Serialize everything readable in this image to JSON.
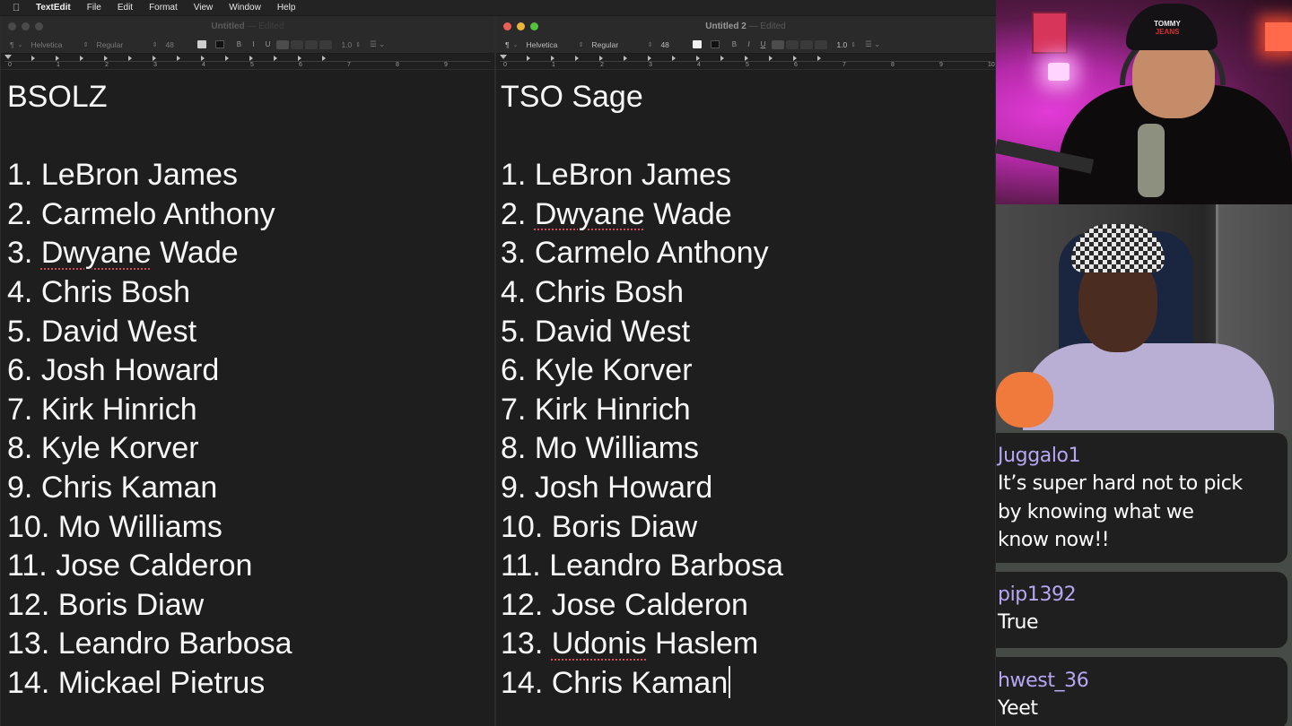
{
  "menubar": {
    "apple_icon": "apple-logo-icon",
    "app_name": "TextEdit",
    "items": [
      "File",
      "Edit",
      "Format",
      "View",
      "Window",
      "Help"
    ]
  },
  "windows": [
    {
      "title": "Untitled",
      "title_suffix": "— Edited",
      "active": false,
      "toolbar": {
        "paragraph_icon": "¶",
        "font": "Helvetica",
        "style": "Regular",
        "size": "48",
        "spacing": "1.0"
      },
      "ruler_numbers": [
        "0",
        "1",
        "2",
        "3",
        "4",
        "5",
        "6",
        "7",
        "8",
        "9"
      ],
      "heading": "BSOLZ",
      "list": [
        {
          "num": "1.",
          "name": "LeBron James"
        },
        {
          "num": "2.",
          "name": "Carmelo Anthony"
        },
        {
          "num": "3.",
          "name": "Dwyane Wade",
          "misspelled": "Dwyane"
        },
        {
          "num": "4.",
          "name": "Chris Bosh"
        },
        {
          "num": "5.",
          "name": "David West"
        },
        {
          "num": "6.",
          "name": "Josh Howard"
        },
        {
          "num": "7.",
          "name": "Kirk Hinrich"
        },
        {
          "num": "8.",
          "name": "Kyle Korver"
        },
        {
          "num": "9.",
          "name": "Chris Kaman"
        },
        {
          "num": "10.",
          "name": "Mo Williams"
        },
        {
          "num": "11.",
          "name": "Jose Calderon"
        },
        {
          "num": "12.",
          "name": "Boris Diaw"
        },
        {
          "num": "13.",
          "name": "Leandro Barbosa"
        },
        {
          "num": "14.",
          "name": "Mickael Pietrus"
        }
      ]
    },
    {
      "title": "Untitled 2",
      "title_suffix": "— Edited",
      "active": true,
      "toolbar": {
        "paragraph_icon": "¶",
        "font": "Helvetica",
        "style": "Regular",
        "size": "48",
        "bold": "B",
        "italic": "I",
        "underline": "U",
        "spacing": "1.0"
      },
      "ruler_numbers": [
        "0",
        "1",
        "2",
        "3",
        "4",
        "5",
        "6",
        "7",
        "8",
        "9",
        "10"
      ],
      "heading": "TSO Sage",
      "list": [
        {
          "num": "1.",
          "name": "LeBron James"
        },
        {
          "num": "2.",
          "name": "Dwyane Wade",
          "misspelled": "Dwyane"
        },
        {
          "num": "3.",
          "name": "Carmelo Anthony"
        },
        {
          "num": "4.",
          "name": "Chris Bosh"
        },
        {
          "num": "5.",
          "name": "David West"
        },
        {
          "num": "6.",
          "name": "Kyle Korver"
        },
        {
          "num": "7.",
          "name": "Kirk Hinrich"
        },
        {
          "num": "8.",
          "name": "Mo Williams"
        },
        {
          "num": "9.",
          "name": "Josh Howard"
        },
        {
          "num": "10.",
          "name": "Boris Diaw"
        },
        {
          "num": "11.",
          "name": "Leandro Barbosa"
        },
        {
          "num": "12.",
          "name": "Jose Calderon"
        },
        {
          "num": "13.",
          "name": "Udonis Haslem",
          "misspelled": "Udonis"
        },
        {
          "num": "14.",
          "name": "Chris Kaman",
          "caret": true
        }
      ]
    }
  ],
  "webcams": {
    "top": {
      "hat_text_line1": "TOMMY",
      "hat_text_line2": "JEANS"
    },
    "bottom": {}
  },
  "chat": {
    "messages": [
      {
        "user": "Juggalo1",
        "lines": [
          "It’s super hard not to pick",
          "by knowing what we",
          "know now!!"
        ]
      },
      {
        "user": "pip1392",
        "lines": [
          "True"
        ]
      },
      {
        "user": "hwest_36",
        "lines": [
          "Yeet"
        ]
      }
    ],
    "colors": {
      "username": "#b7a6f2",
      "message": "#ffffff",
      "bubble": "#1f1f1f"
    }
  }
}
